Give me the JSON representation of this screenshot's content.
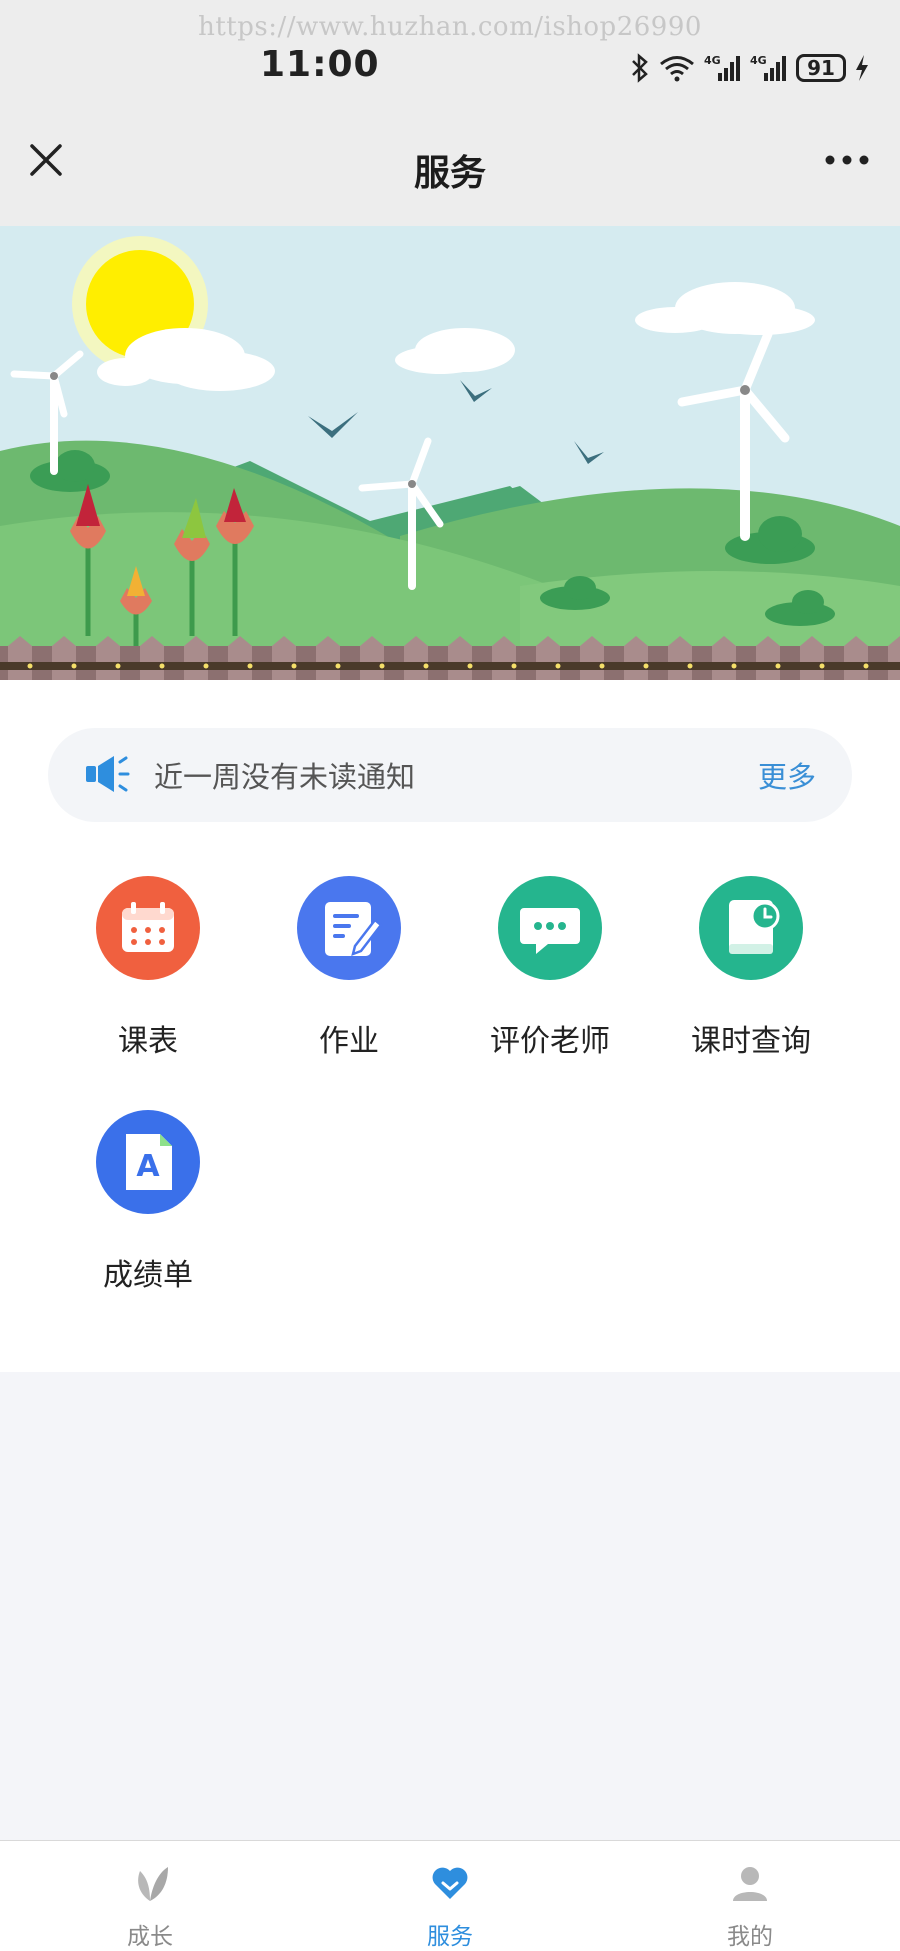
{
  "status_bar": {
    "watermark": "https://www.huzhan.com/ishop26990",
    "time": "11:00",
    "battery": "91",
    "icons": [
      "bluetooth-icon",
      "wifi-icon",
      "signal-4g-icon",
      "signal-4g-icon",
      "battery-icon",
      "charging-icon"
    ]
  },
  "nav": {
    "title": "服务",
    "close_icon": "close-icon",
    "more_icon": "more-icon"
  },
  "banner": {
    "icon": "landscape-banner"
  },
  "notice": {
    "text": "近一周没有未读通知",
    "more": "更多",
    "icon": "megaphone-icon"
  },
  "services": [
    {
      "label": "课表",
      "icon": "calendar-icon",
      "color": "#f0603f"
    },
    {
      "label": "作业",
      "icon": "homework-icon",
      "color": "#4a77ee"
    },
    {
      "label": "评价老师",
      "icon": "chat-icon",
      "color": "#25b58e"
    },
    {
      "label": "课时查询",
      "icon": "book-clock-icon",
      "color": "#25b58e"
    },
    {
      "label": "成绩单",
      "icon": "report-card-icon",
      "color": "#3a70ea"
    }
  ],
  "tabs": [
    {
      "label": "成长",
      "icon": "leaf-icon",
      "active": false
    },
    {
      "label": "服务",
      "icon": "heart-icon",
      "active": true
    },
    {
      "label": "我的",
      "icon": "user-icon",
      "active": false
    }
  ],
  "colors": {
    "accent": "#2e8ede",
    "background": "#f4f5f9"
  }
}
